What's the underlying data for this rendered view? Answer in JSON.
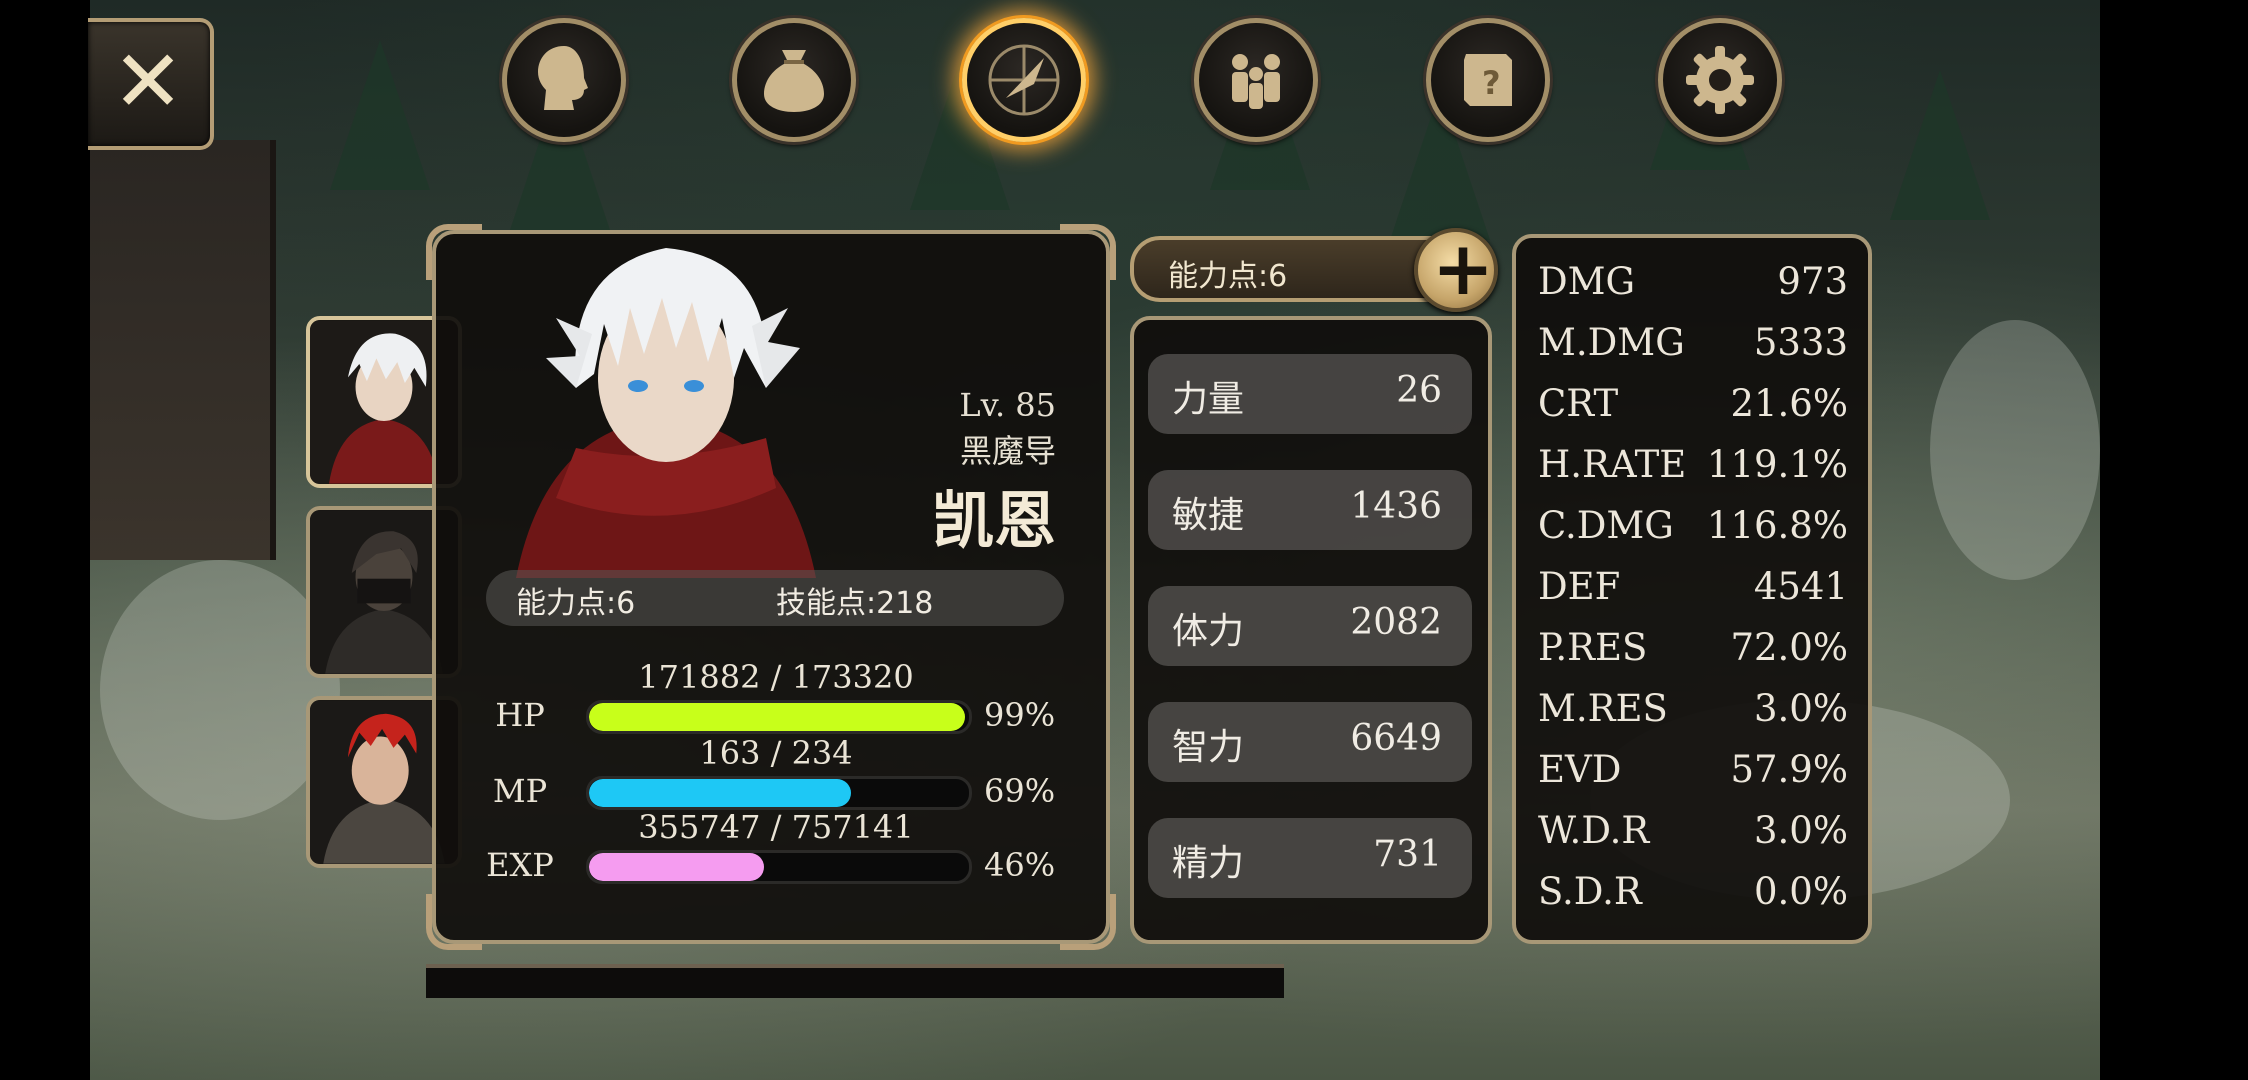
{
  "nav": {
    "close_label": "✕",
    "tabs": [
      {
        "icon": "head-icon",
        "active": false
      },
      {
        "icon": "bag-icon",
        "active": false
      },
      {
        "icon": "skill-compass-icon",
        "active": true
      },
      {
        "icon": "party-icon",
        "active": false
      },
      {
        "icon": "quest-scroll-icon",
        "active": false
      },
      {
        "icon": "gear-icon",
        "active": false
      }
    ]
  },
  "character": {
    "level": "Lv. 85",
    "class": "黑魔导",
    "name": "凯恩",
    "ability_points": "能力点:6",
    "skill_points": "技能点:218",
    "hp": {
      "label": "HP",
      "value": "171882 / 173320",
      "pct": "99%",
      "fraction": 0.99,
      "color": "#c8ff1a"
    },
    "mp": {
      "label": "MP",
      "value": "163 / 234",
      "pct": "69%",
      "fraction": 0.69,
      "color": "#1ec8f5"
    },
    "exp": {
      "label": "EXP",
      "value": "355747 / 757141",
      "pct": "46%",
      "fraction": 0.46,
      "color": "#f59cf0"
    }
  },
  "attributes": {
    "header": "能力点:6",
    "plus_label": "+",
    "rows": [
      {
        "name": "力量",
        "value": "26"
      },
      {
        "name": "敏捷",
        "value": "1436"
      },
      {
        "name": "体力",
        "value": "2082"
      },
      {
        "name": "智力",
        "value": "6649"
      },
      {
        "name": "精力",
        "value": "731"
      }
    ]
  },
  "stats": [
    {
      "key": "DMG",
      "value": "973"
    },
    {
      "key": "M.DMG",
      "value": "5333"
    },
    {
      "key": "CRT",
      "value": "21.6%"
    },
    {
      "key": "H.RATE",
      "value": "119.1%"
    },
    {
      "key": "C.DMG",
      "value": "116.8%"
    },
    {
      "key": "DEF",
      "value": "4541"
    },
    {
      "key": "P.RES",
      "value": "72.0%"
    },
    {
      "key": "M.RES",
      "value": "3.0%"
    },
    {
      "key": "EVD",
      "value": "57.9%"
    },
    {
      "key": "W.D.R",
      "value": "3.0%"
    },
    {
      "key": "S.D.R",
      "value": "0.0%"
    }
  ]
}
